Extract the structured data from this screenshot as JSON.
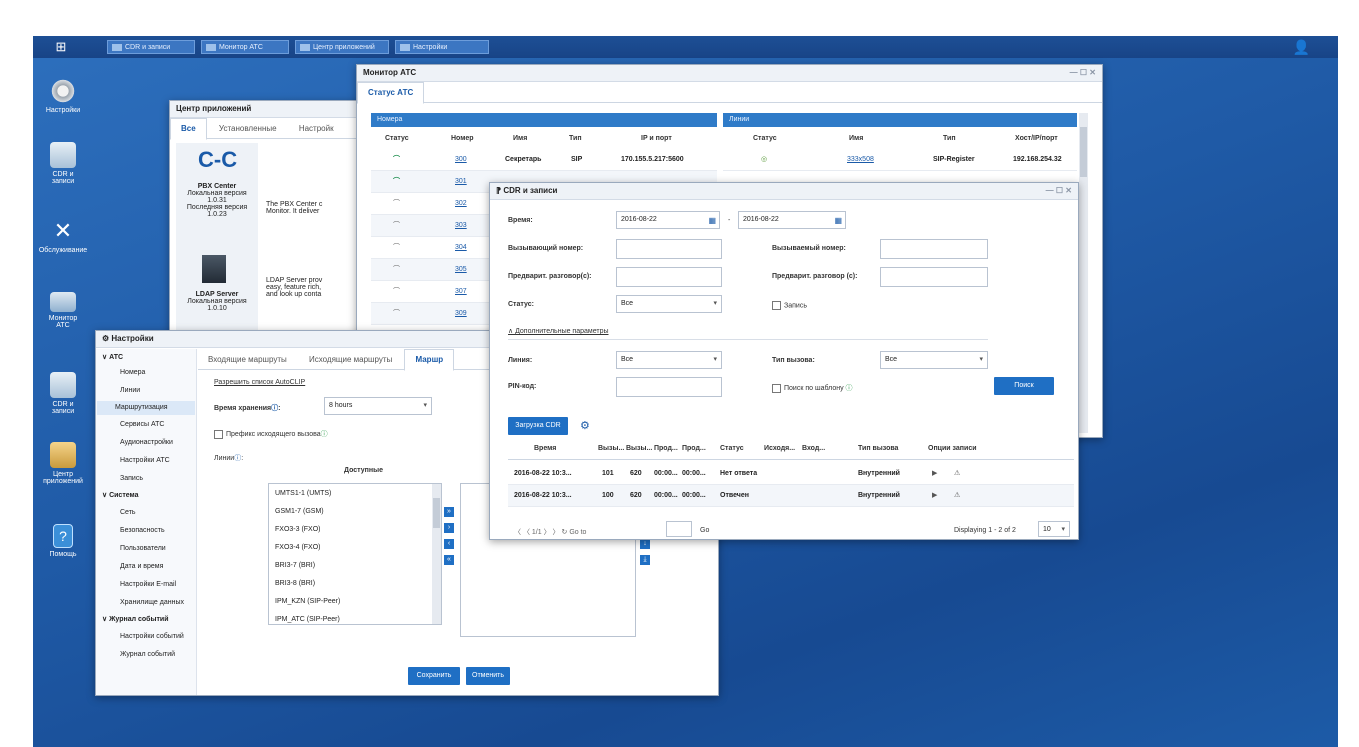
{
  "taskbar": {
    "items": [
      "CDR и записи",
      "Монитор АТС",
      "Центр приложений",
      "Настройки"
    ]
  },
  "desktop_icons": [
    {
      "label": "Настройки",
      "icon": "gear-icon"
    },
    {
      "label": "CDR и записи",
      "icon": "cdr-icon"
    },
    {
      "label": "Обслуживание",
      "icon": "tools-icon"
    },
    {
      "label": "Монитор АТС",
      "icon": "monitor-icon"
    },
    {
      "label": "CDR и записи",
      "icon": "cdr-icon"
    },
    {
      "label": "Центр приложений",
      "icon": "box-icon"
    },
    {
      "label": "Помощь",
      "icon": "help-icon"
    }
  ],
  "app_center": {
    "title": "Центр приложений",
    "tabs": [
      "Все",
      "Установленные",
      "Настройк"
    ],
    "apps": [
      {
        "name": "PBX Center",
        "local_label": "Локальная версия",
        "local": "1.0.31",
        "latest_label": "Последняя версия",
        "latest": "1.0.23",
        "desc1": "The PBX Center c",
        "desc2": "Monitor. It deliver"
      },
      {
        "name": "LDAP Server",
        "local_label": "Локальная версия",
        "local": "1.0.10",
        "desc1": "LDAP Server prov",
        "desc2": "easy, feature rich,",
        "desc3": "and look up conta"
      }
    ]
  },
  "monitor": {
    "title": "Монитор АТС",
    "tab": "Статус АТС",
    "ext_header": "Номера",
    "trunk_header": "Линии",
    "ext_cols": [
      "Статус",
      "Номер",
      "Имя",
      "Тип",
      "IP и порт"
    ],
    "trunk_cols": [
      "Статус",
      "Имя",
      "Тип",
      "Хост/IP/порт"
    ],
    "ext_rows": [
      {
        "number": "300",
        "name": "Секретарь",
        "type": "SIP",
        "ip": "170.155.5.217:5600",
        "active": true
      },
      {
        "number": "301",
        "active": true
      },
      {
        "number": "302",
        "active": false
      },
      {
        "number": "303",
        "active": false
      },
      {
        "number": "304",
        "active": false
      },
      {
        "number": "305",
        "active": false
      },
      {
        "number": "307",
        "active": false
      },
      {
        "number": "309",
        "active": false
      }
    ],
    "trunk_row": {
      "name": "333x508",
      "type": "SIP-Register",
      "host": "192.168.254.32"
    }
  },
  "cdr": {
    "title": "CDR и записи",
    "time_label": "Время:",
    "date_from": "2016-08-22",
    "date_sep": "-",
    "date_to": "2016-08-22",
    "caller_label": "Вызывающий номер:",
    "callee_label": "Вызываемый номер:",
    "prev_caller_label": "Предварит. разговор(с):",
    "prev_callee_label": "Предварит. разговор (с):",
    "status_label": "Статус:",
    "status_value": "Все",
    "record_label": "Запись",
    "advanced_label": "Дополнительные параметры",
    "line_label": "Линия:",
    "line_value": "Все",
    "calltype_label": "Тип вызова:",
    "calltype_value": "Все",
    "pin_label": "PIN-код:",
    "template_label": "Поиск по шаблону",
    "search_btn": "Поиск",
    "download_btn": "Загрузка CDR",
    "columns": [
      "Время",
      "Вызы...",
      "Вызы...",
      "Прод...",
      "Прод...",
      "Статус",
      "Исходя...",
      "Вход...",
      "Тип вызова",
      "Опции записи"
    ],
    "rows": [
      {
        "time": "2016-08-22 10:3...",
        "from": "101",
        "to": "620",
        "d1": "00:00...",
        "d2": "00:00...",
        "status": "Нет ответа",
        "type": "Внутренний"
      },
      {
        "time": "2016-08-22 10:3...",
        "from": "100",
        "to": "620",
        "d1": "00:00...",
        "d2": "00:00...",
        "status": "Отвечен",
        "type": "Внутренний"
      }
    ],
    "pager": {
      "page": "1/1",
      "goto_label": "Go to",
      "go_btn": "Go",
      "display": "Displaying 1 - 2 of 2",
      "per_page": "10"
    }
  },
  "settings": {
    "title": "Настройки",
    "sidebar": [
      {
        "label": "АТС",
        "group": true
      },
      {
        "label": "Номера"
      },
      {
        "label": "Линии"
      },
      {
        "label": "Маршрутизация",
        "selected": true
      },
      {
        "label": "Сервисы АТС"
      },
      {
        "label": "Аудионастройки"
      },
      {
        "label": "Настройки АТС"
      },
      {
        "label": "Запись"
      },
      {
        "label": "Система",
        "group": true
      },
      {
        "label": "Сеть"
      },
      {
        "label": "Безопасность"
      },
      {
        "label": "Пользователи"
      },
      {
        "label": "Дата и время"
      },
      {
        "label": "Настройки E-mail"
      },
      {
        "label": "Хранилище данных"
      },
      {
        "label": "Журнал событий",
        "group": true
      },
      {
        "label": "Настройки событий"
      },
      {
        "label": "Журнал событий"
      }
    ],
    "tabs": [
      "Входящие маршруты",
      "Исходящие маршруты",
      "Маршр"
    ],
    "autoclip_link": "Разрешить список AutoCLIP",
    "storage_label": "Время хранения",
    "storage_value": "8 hours",
    "prefix_label": "Префикс исходящего вызова",
    "lines_label": "Линии",
    "available_label": "Доступные",
    "available": [
      "UMTS1-1 (UMTS)",
      "GSM1-7 (GSM)",
      "FXO3-3 (FXO)",
      "FXO3-4 (FXO)",
      "BRI3-7 (BRI)",
      "BRI3-8 (BRI)",
      "IPM_KZN (SIP-Peer)",
      "IPM_ATC (SIP-Peer)"
    ],
    "save_btn": "Сохранить",
    "cancel_btn": "Отменить"
  },
  "colors": {
    "desktop": "#1f5aa6",
    "accent": "#1f6fc4",
    "header": "#2f7bc8"
  }
}
